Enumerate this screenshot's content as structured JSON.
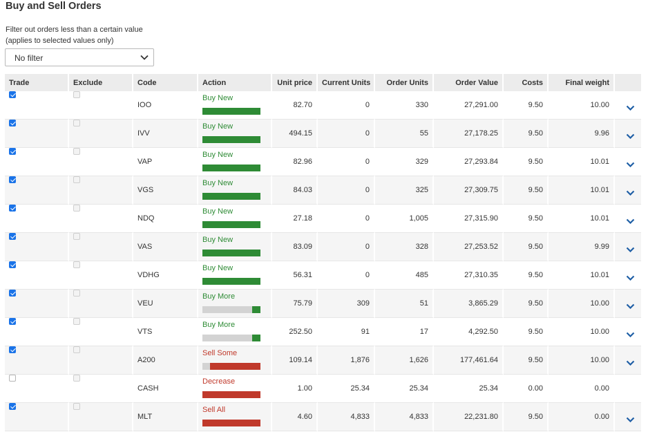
{
  "header": {
    "title": "Buy and Sell Orders",
    "filter_hint_line1": "Filter out orders less than a certain value",
    "filter_hint_line2": "(applies to selected values only)",
    "filter_value": "No filter"
  },
  "colors": {
    "buy": "#2e8b35",
    "sell": "#c0392b",
    "bar_empty": "#d3d3d3",
    "checkbox": "#1a73e8"
  },
  "columns": [
    "Trade",
    "Exclude",
    "Code",
    "Action",
    "Unit price",
    "Current Units",
    "Order Units",
    "Order Value",
    "Costs",
    "Final weight"
  ],
  "rows": [
    {
      "trade": true,
      "code": "IOO",
      "action": "Buy New",
      "kind": "buy",
      "bar_fraction": 1.0,
      "unit_price": "82.70",
      "current_units": "0",
      "order_units": "330",
      "order_value": "27,291.00",
      "costs": "9.50",
      "final_weight": "10.00",
      "expand": true
    },
    {
      "trade": true,
      "code": "IVV",
      "action": "Buy New",
      "kind": "buy",
      "bar_fraction": 1.0,
      "unit_price": "494.15",
      "current_units": "0",
      "order_units": "55",
      "order_value": "27,178.25",
      "costs": "9.50",
      "final_weight": "9.96",
      "expand": true
    },
    {
      "trade": true,
      "code": "VAP",
      "action": "Buy New",
      "kind": "buy",
      "bar_fraction": 1.0,
      "unit_price": "82.96",
      "current_units": "0",
      "order_units": "329",
      "order_value": "27,293.84",
      "costs": "9.50",
      "final_weight": "10.01",
      "expand": true
    },
    {
      "trade": true,
      "code": "VGS",
      "action": "Buy New",
      "kind": "buy",
      "bar_fraction": 1.0,
      "unit_price": "84.03",
      "current_units": "0",
      "order_units": "325",
      "order_value": "27,309.75",
      "costs": "9.50",
      "final_weight": "10.01",
      "expand": true
    },
    {
      "trade": true,
      "code": "NDQ",
      "action": "Buy New",
      "kind": "buy",
      "bar_fraction": 1.0,
      "unit_price": "27.18",
      "current_units": "0",
      "order_units": "1,005",
      "order_value": "27,315.90",
      "costs": "9.50",
      "final_weight": "10.01",
      "expand": true
    },
    {
      "trade": true,
      "code": "VAS",
      "action": "Buy New",
      "kind": "buy",
      "bar_fraction": 1.0,
      "unit_price": "83.09",
      "current_units": "0",
      "order_units": "328",
      "order_value": "27,253.52",
      "costs": "9.50",
      "final_weight": "9.99",
      "expand": true
    },
    {
      "trade": true,
      "code": "VDHG",
      "action": "Buy New",
      "kind": "buy",
      "bar_fraction": 1.0,
      "unit_price": "56.31",
      "current_units": "0",
      "order_units": "485",
      "order_value": "27,310.35",
      "costs": "9.50",
      "final_weight": "10.01",
      "expand": true
    },
    {
      "trade": true,
      "code": "VEU",
      "action": "Buy More",
      "kind": "buy",
      "bar_fraction": 0.14,
      "unit_price": "75.79",
      "current_units": "309",
      "order_units": "51",
      "order_value": "3,865.29",
      "costs": "9.50",
      "final_weight": "10.00",
      "expand": true
    },
    {
      "trade": true,
      "code": "VTS",
      "action": "Buy More",
      "kind": "buy",
      "bar_fraction": 0.14,
      "unit_price": "252.50",
      "current_units": "91",
      "order_units": "17",
      "order_value": "4,292.50",
      "costs": "9.50",
      "final_weight": "10.00",
      "expand": true
    },
    {
      "trade": true,
      "code": "A200",
      "action": "Sell Some",
      "kind": "sell",
      "bar_fraction": 0.87,
      "unit_price": "109.14",
      "current_units": "1,876",
      "order_units": "1,626",
      "order_value": "177,461.64",
      "costs": "9.50",
      "final_weight": "10.00",
      "expand": true
    },
    {
      "trade": false,
      "code": "CASH",
      "action": "Decrease",
      "kind": "sell",
      "bar_fraction": 1.0,
      "unit_price": "1.00",
      "current_units": "25.34",
      "order_units": "25.34",
      "order_value": "25.34",
      "costs": "0.00",
      "final_weight": "0.00",
      "expand": false
    },
    {
      "trade": true,
      "code": "MLT",
      "action": "Sell All",
      "kind": "sell",
      "bar_fraction": 1.0,
      "unit_price": "4.60",
      "current_units": "4,833",
      "order_units": "4,833",
      "order_value": "22,231.80",
      "costs": "9.50",
      "final_weight": "0.00",
      "expand": true
    }
  ]
}
